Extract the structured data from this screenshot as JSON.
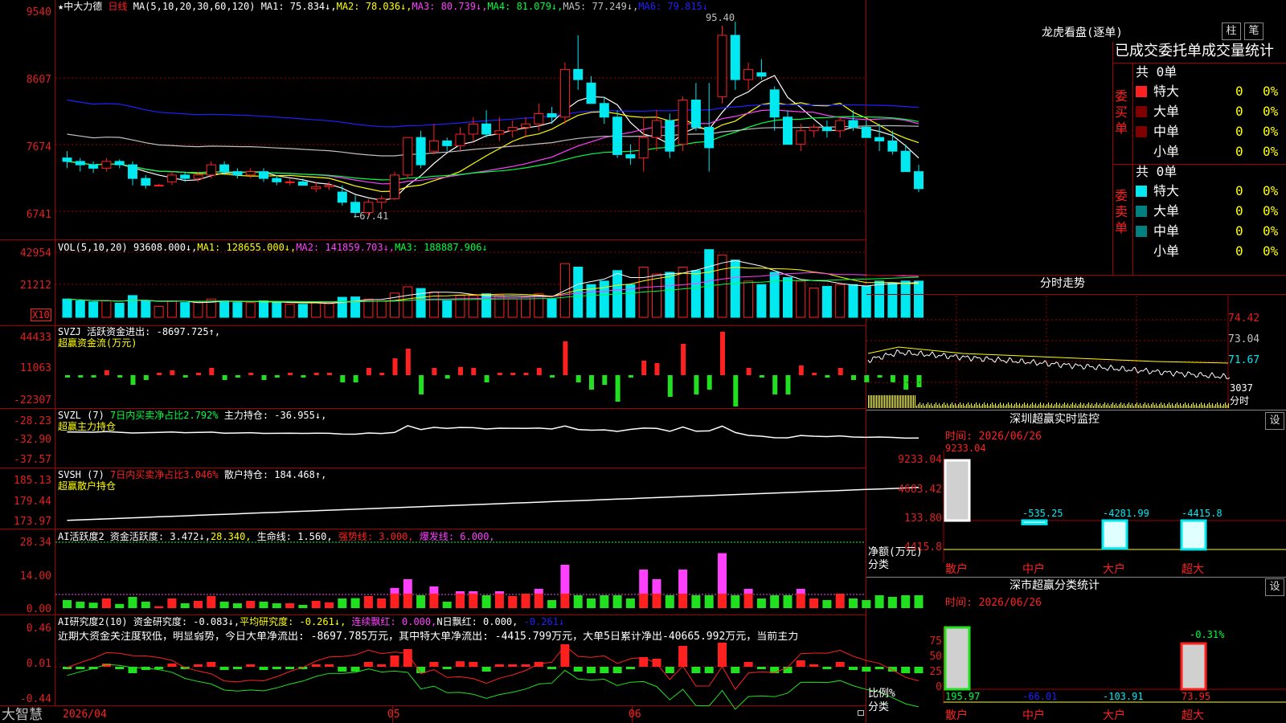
{
  "colors": {
    "up": "#ff2020",
    "down": "#00e8f0",
    "grid": "#a00000",
    "white": "#ffffff",
    "yellow": "#ffff00",
    "magenta": "#ff40ff",
    "green": "#00ff40",
    "blue": "#2020ff",
    "gray": "#c0c0c0",
    "grn_bar": "#20e020"
  },
  "main": {
    "axis": [
      "9540",
      "8607",
      "7674",
      "6741"
    ],
    "title": {
      "star": "★",
      "name": "中大力德",
      "period": "日线",
      "ma_label": "MA(5,10,20,30,60,120)",
      "ma1": "MA1: 75.834↓,",
      "ma2": "MA2: 78.036↓,",
      "ma3": "MA3: 80.739↓,",
      "ma4": "MA4: 81.079↓,",
      "ma5": "MA5: 77.249↓,",
      "ma6": "MA6: 79.815↓"
    },
    "high_label": "95.40",
    "low_label": "←67.41",
    "candles": [
      [
        76,
        77,
        74.5,
        75.5
      ],
      [
        75.5,
        76,
        74,
        75
      ],
      [
        75,
        75.5,
        73.8,
        74.5
      ],
      [
        74.5,
        76,
        74,
        75.5
      ],
      [
        75.5,
        75.8,
        74.5,
        75
      ],
      [
        75,
        75.5,
        72,
        73
      ],
      [
        73,
        73.5,
        71.5,
        72
      ],
      [
        72,
        72.2,
        71.8,
        72
      ],
      [
        72.5,
        74,
        72,
        73.5
      ],
      [
        73.5,
        74,
        72.5,
        73
      ],
      [
        73,
        74,
        72.5,
        73.5
      ],
      [
        73.5,
        75.5,
        73,
        75
      ],
      [
        75,
        75.5,
        73.5,
        74
      ],
      [
        74,
        74.5,
        73,
        73.5
      ],
      [
        73.5,
        74.5,
        73,
        74
      ],
      [
        74,
        74.5,
        72.5,
        73
      ],
      [
        73,
        73.5,
        72,
        72.5
      ],
      [
        72.5,
        73,
        72,
        72.5
      ],
      [
        72.5,
        73,
        72,
        72
      ],
      [
        71.5,
        72.5,
        71,
        71.8
      ],
      [
        71.8,
        72.5,
        71.3,
        72
      ],
      [
        71,
        72,
        69,
        69.5
      ],
      [
        69.5,
        70.5,
        67.4,
        68
      ],
      [
        68,
        70,
        67.5,
        69.5
      ],
      [
        69.5,
        70.5,
        68.5,
        70
      ],
      [
        70,
        74,
        69.8,
        73.5
      ],
      [
        73.5,
        79,
        73,
        79
      ],
      [
        79,
        80,
        74.5,
        75
      ],
      [
        77,
        81,
        76.5,
        78.5
      ],
      [
        78.5,
        79,
        77,
        77.8
      ],
      [
        77.8,
        80.5,
        77,
        79.5
      ],
      [
        79.5,
        82,
        78.5,
        81
      ],
      [
        81,
        83,
        79,
        79.5
      ],
      [
        79.5,
        82,
        78.5,
        80
      ],
      [
        80,
        81.5,
        79,
        80.5
      ],
      [
        80.5,
        82,
        79,
        81
      ],
      [
        81,
        84,
        80,
        82.5
      ],
      [
        82.5,
        83.5,
        81,
        82
      ],
      [
        82,
        90,
        81,
        89
      ],
      [
        89,
        94,
        86,
        87.5
      ],
      [
        87,
        88,
        85,
        84
      ],
      [
        84,
        85,
        81,
        82
      ],
      [
        82,
        83,
        76,
        76.5
      ],
      [
        76.5,
        78,
        75,
        76
      ],
      [
        76,
        82,
        74,
        79
      ],
      [
        79,
        83,
        77,
        81.5
      ],
      [
        81.5,
        82.5,
        76,
        77
      ],
      [
        78,
        85,
        77,
        84.5
      ],
      [
        84.5,
        87,
        80,
        80.5
      ],
      [
        80.5,
        87,
        74,
        77.5
      ],
      [
        85,
        95.4,
        84,
        94
      ],
      [
        94,
        96,
        86,
        87.5
      ],
      [
        87.5,
        90,
        86,
        89
      ],
      [
        88.5,
        90.5,
        87.5,
        88
      ],
      [
        86,
        86.5,
        80,
        82
      ],
      [
        82,
        83,
        78,
        78
      ],
      [
        78,
        81,
        77,
        80
      ],
      [
        80,
        81,
        79,
        80.5
      ],
      [
        80.5,
        81.5,
        79,
        80
      ],
      [
        80,
        82,
        79,
        81.5
      ],
      [
        81.5,
        83,
        80,
        80.5
      ],
      [
        80.5,
        81.5,
        79,
        79
      ],
      [
        79,
        81,
        77,
        78.5
      ],
      [
        78.5,
        80,
        76.5,
        77
      ],
      [
        77,
        78,
        74,
        74
      ],
      [
        74,
        75,
        71,
        71.5
      ]
    ],
    "yrange": [
      65,
      98
    ]
  },
  "vol": {
    "axis": [
      "42954",
      "21212"
    ],
    "x10": "X10",
    "title": {
      "label": "VOL(5,10,20)",
      "v": "93608.000↓,",
      "ma1": "MA1: 128655.000↓,",
      "ma2": "MA2: 141859.703↓,",
      "ma3": "MA3: 188887.906↓"
    },
    "max": 48000
  },
  "svzj": {
    "axis": [
      "44433",
      "11063",
      "-22307"
    ],
    "title": {
      "name": "SVZJ",
      "label": "活跃资金进出: -8697.725↑,",
      "sub": "超赢资金流(万元)"
    }
  },
  "svzl": {
    "axis": [
      "-28.23",
      "-32.90",
      "-37.57"
    ],
    "title": {
      "name": "SVZL (7)",
      "label": "7日内买卖净占比2.792%",
      "val": "主力持仓: -36.955↓,",
      "sub": "超赢主力持仓"
    }
  },
  "svsh": {
    "axis": [
      "185.13",
      "179.44",
      "173.97"
    ],
    "title": {
      "name": "SVSH (7)",
      "label": "7日内买卖净占比3.046%",
      "val": "散户持仓: 184.468↑,",
      "sub": "超赢散户持仓"
    }
  },
  "ai": {
    "axis": [
      "28.34",
      "14.00",
      "0.00"
    ],
    "title": {
      "name": "AI活跃度2",
      "a": "资金活跃度: 3.472↓,",
      "b": "28.340,",
      "c": "生命线: 1.560,",
      "d": "强势线: 3.000,",
      "e": "爆发线: 6.000,"
    }
  },
  "ai2": {
    "axis": [
      "0.46",
      "0.01",
      "-0.44"
    ],
    "title": {
      "name": "AI研究度2(10)",
      "a": "资金研究度: -0.083↓,",
      "b": "平均研究度: -0.261↓,",
      "c": "连续飘红: 0.000,",
      "d": "N日飘红: 0.000,",
      "e": "-0.261↓"
    },
    "text": "近期大资金关注度较低，明显弱势，今日大单净流出: -8697.785万元，其中特大单净流出: -4415.799万元，大单5日累计净出-40665.992万元，当前主力"
  },
  "bottom": {
    "brand": "大智慧",
    "d1": "2026/04",
    "d2": "05",
    "d3": "06"
  },
  "right": {
    "title": "龙虎看盘(逐单)",
    "btn1": "柱",
    "btn2": "笔",
    "header": "已成交委托单成交量统计",
    "buy": {
      "label": "委买单",
      "total": "共 0单",
      "rows": [
        [
          "特大",
          "0",
          "0%"
        ],
        [
          "大单",
          "0",
          "0%"
        ],
        [
          "中单",
          "0",
          "0%"
        ],
        [
          "小单",
          "0",
          "0%"
        ]
      ]
    },
    "sell": {
      "label": "委卖单",
      "total": "共 0单",
      "rows": [
        [
          "特大",
          "0",
          "0%"
        ],
        [
          "大单",
          "0",
          "0%"
        ],
        [
          "中单",
          "0",
          "0%"
        ],
        [
          "小单",
          "0",
          "0%"
        ]
      ]
    },
    "fenshi": {
      "title": "分时走势",
      "axis": [
        "74.42",
        "73.04",
        "71.67",
        "3037"
      ],
      "label": "分时"
    },
    "monitor": {
      "title": "深圳超赢实时监控",
      "btn": "设",
      "time": "时间: 2026/06/26",
      "axis": [
        "9233.04",
        "4683.42",
        "133.80",
        "-4415.8"
      ],
      "ylabel": "净额(万元)",
      "xlabel": "分类",
      "values": [
        "9233.04",
        "-535.25",
        "-4281.99",
        "-4415.8"
      ],
      "cats": [
        "散户",
        "中户",
        "大户",
        "超大"
      ],
      "nums": [
        9233.04,
        -535.25,
        -4281.99,
        -4415.8
      ]
    },
    "classify": {
      "title": "深市超赢分类统计",
      "btn": "设",
      "time": "时间: 2026/06/26",
      "axis": [
        "75",
        "50",
        "25",
        "0"
      ],
      "ylabel": "比例%",
      "xlabel": "分类",
      "top": "-0.31%",
      "values": [
        "195.97",
        "-66.01",
        "-103.91",
        "73.95"
      ],
      "cats": [
        "散户",
        "中户",
        "大户",
        "超大"
      ]
    }
  }
}
